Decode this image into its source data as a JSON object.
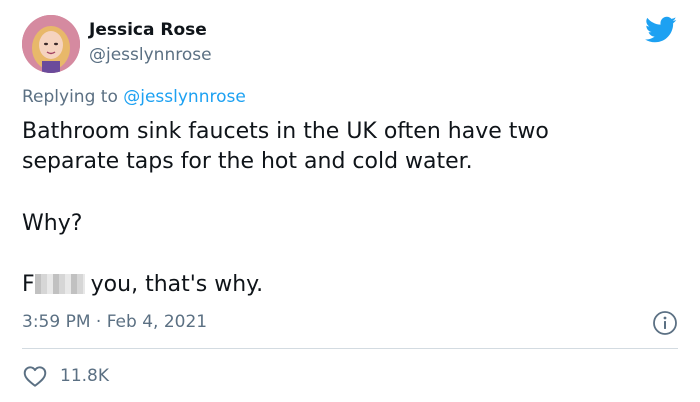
{
  "author": {
    "display_name": "Jessica Rose",
    "handle": "@jesslynnrose"
  },
  "reply": {
    "prefix": "Replying to",
    "mention": "@jesslynnrose"
  },
  "tweet": {
    "line1": "Bathroom sink faucets in the UK often have two",
    "line2": "separate taps for the hot and cold water.",
    "line3": "Why?",
    "line4_start": "F",
    "line4_end": "you, that's why."
  },
  "meta": {
    "timestamp": "3:59 PM · Feb 4, 2021"
  },
  "engagement": {
    "likes": "11.8K"
  },
  "icons": {
    "brand": "twitter-bird-icon",
    "info": "info-icon",
    "like": "heart-icon"
  },
  "colors": {
    "brand_blue": "#1da1f2",
    "secondary_text": "#5b7083",
    "primary_text": "#0f1419"
  }
}
